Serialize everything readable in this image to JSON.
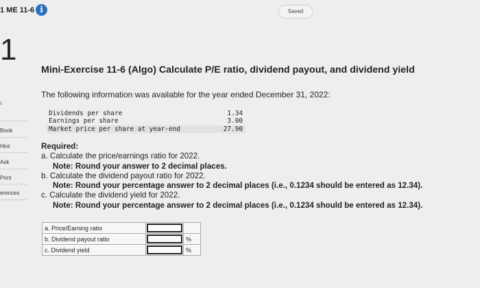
{
  "header": {
    "assignment_title": "1 ME 11-6",
    "info_icon": "info-icon",
    "saved_status": "Saved"
  },
  "question_number": "1",
  "sidebar": {
    "items": [
      {
        "label": "Book",
        "icon": "book-icon"
      },
      {
        "label": "Hint",
        "icon": "hint-icon"
      },
      {
        "label": "Ask",
        "icon": "ask-icon"
      },
      {
        "label": "Print",
        "icon": "print-icon"
      },
      {
        "label": "erences",
        "icon": "references-icon"
      }
    ]
  },
  "problem": {
    "title": "Mini-Exercise 11-6 (Algo) Calculate P/E ratio, dividend payout, and dividend yield",
    "intro": "The following information was available for the year ended December 31, 2022:",
    "given": [
      {
        "label": "Dividends per share",
        "value": "1.34"
      },
      {
        "label": "Earnings per share",
        "value": "3.00"
      },
      {
        "label": "Market price per share at year-end",
        "value": "27.90"
      }
    ],
    "required_label": "Required:",
    "requirements": [
      {
        "text": "a. Calculate the price/earnings ratio for 2022.",
        "note": "Note: Round your answer to 2 decimal places."
      },
      {
        "text": "b. Calculate the dividend payout ratio for 2022.",
        "note": "Note: Round your percentage answer to 2 decimal places (i.e., 0.1234 should be entered as 12.34)."
      },
      {
        "text": "c. Calculate the dividend yield for 2022.",
        "note": "Note: Round your percentage answer to 2 decimal places (i.e., 0.1234 should be entered as 12.34)."
      }
    ]
  },
  "answer_table": {
    "rows": [
      {
        "label": "a. Price/Earning ratio",
        "value": "",
        "unit": ""
      },
      {
        "label": "b. Dividend payout ratio",
        "value": "",
        "unit": "%"
      },
      {
        "label": "c. Dividend yield",
        "value": "",
        "unit": "%"
      }
    ]
  }
}
